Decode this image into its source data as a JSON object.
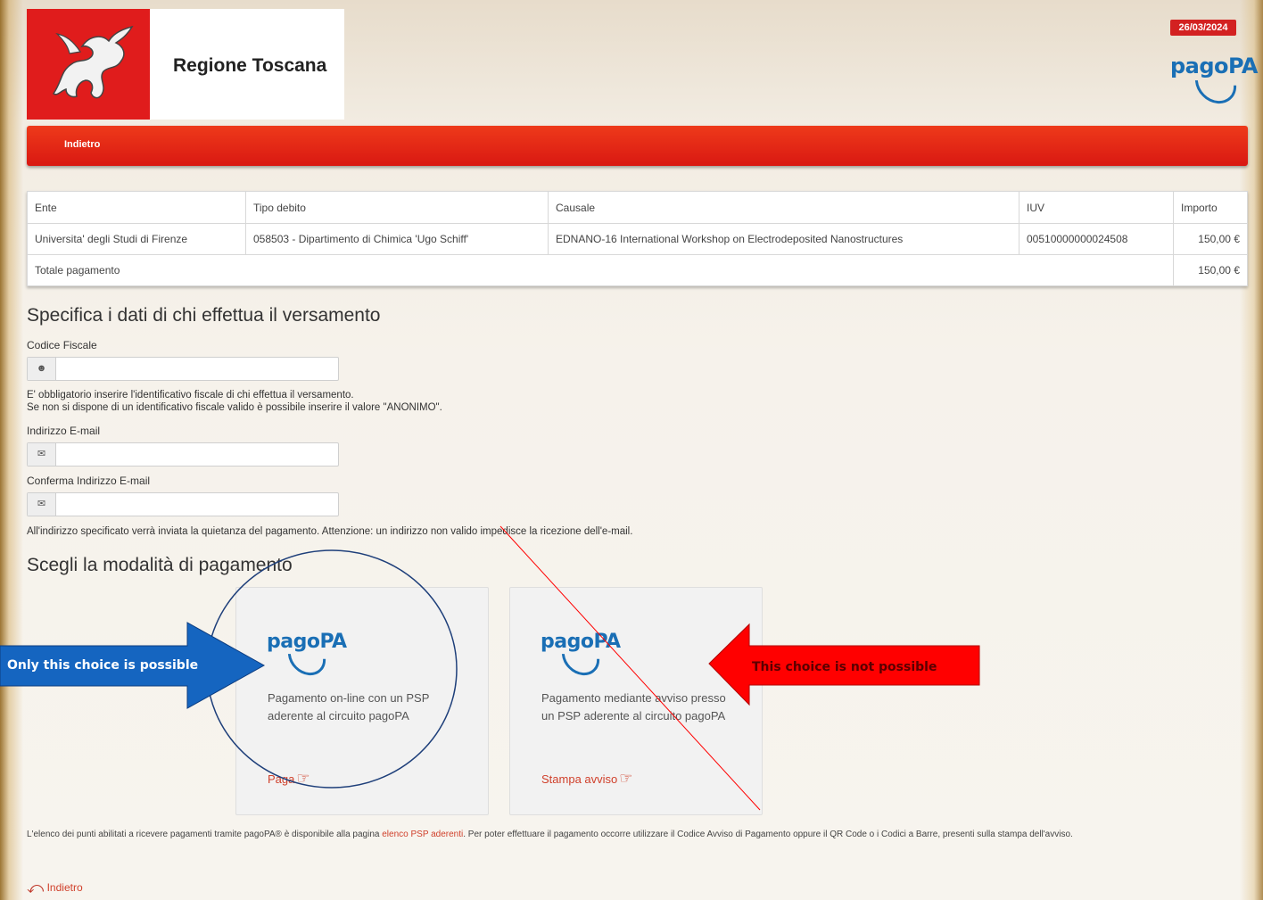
{
  "header": {
    "region_title": "Regione Toscana",
    "date": "26/03/2024",
    "logo_text": "pagoPA"
  },
  "nav": {
    "back_label": "Indietro"
  },
  "debt_table": {
    "columns": [
      "Ente",
      "Tipo debito",
      "Causale",
      "IUV",
      "Importo"
    ],
    "rows": [
      [
        "Universita' degli Studi di Firenze",
        "058503 - Dipartimento di Chimica 'Ugo Schiff'",
        "EDNANO-16 International Workshop on Electrodeposited Nanostructures",
        "00510000000024508",
        "150,00 €"
      ]
    ],
    "total_label": "Totale pagamento",
    "total_value": "150,00 €"
  },
  "payer": {
    "heading": "Specifica i dati di chi effettua il versamento",
    "fiscal_code_label": "Codice Fiscale",
    "fiscal_note_1": "E' obbligatorio inserire l'identificativo fiscale di chi effettua il versamento.",
    "fiscal_note_2": "Se non si dispone di un identificativo fiscale valido è possibile inserire il valore \"ANONIMO\".",
    "email_label": "Indirizzo E-mail",
    "email_confirm_label": "Conferma Indirizzo E-mail",
    "email_note": "All'indirizzo specificato verrà inviata la quietanza del pagamento. Attenzione: un indirizzo non valido impedisce la ricezione dell'e-mail."
  },
  "payment": {
    "heading": "Scegli la modalità di pagamento",
    "online": {
      "logo": "pagoPA",
      "desc": "Pagamento on-line con un PSP aderente al circuito pagoPA",
      "action": "Paga"
    },
    "notice": {
      "logo": "pagoPA",
      "desc": "Pagamento mediante avviso presso un PSP aderente al circuito pagoPA",
      "action": "Stampa avviso"
    }
  },
  "footer": {
    "text_before": "L'elenco dei punti abilitati a ricevere pagamenti tramite pagoPA® è disponibile alla pagina ",
    "link": "elenco PSP aderenti",
    "text_after": ". Per poter effettuare il pagamento occorre utilizzare il Codice Avviso di Pagamento oppure il QR Code o i Codici a Barre, presenti sulla stampa dell'avviso.",
    "back_label": "Indietro"
  },
  "annotations": {
    "possible": "Only this choice  is possible",
    "not_possible": "This choice is not possible"
  },
  "colors": {
    "brand_red": "#e01c1c",
    "pagopa_blue": "#1a6fb5",
    "link_red": "#d0402b",
    "annotation_blue": "#1565c0",
    "annotation_red": "#ff0000"
  }
}
